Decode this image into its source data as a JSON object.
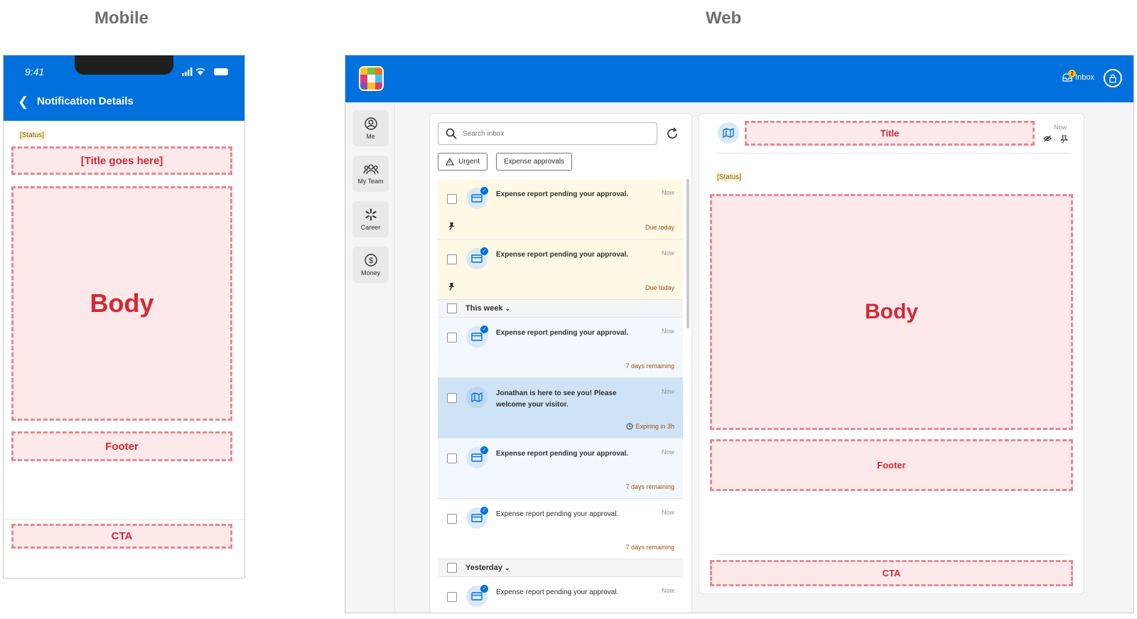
{
  "labels": {
    "mobile": "Mobile",
    "web": "Web"
  },
  "mobile": {
    "time": "9:41",
    "nav_title": "Notification Details",
    "status": "[Status]",
    "title_placeholder": "[Title goes here]",
    "body": "Body",
    "footer": "Footer",
    "cta": "CTA"
  },
  "web": {
    "header": {
      "inbox_label": "Inbox",
      "inbox_count": "2"
    },
    "rail": [
      {
        "label": "Me",
        "icon": "user-circle-icon"
      },
      {
        "label": "My Team",
        "icon": "team-icon"
      },
      {
        "label": "Career",
        "icon": "spark-icon"
      },
      {
        "label": "Money",
        "icon": "dollar-icon"
      }
    ],
    "search": {
      "placeholder": "Search inbox"
    },
    "chips": [
      {
        "label": "Urgent",
        "icon": "warning-icon"
      },
      {
        "label": "Expense approvals"
      }
    ],
    "items": [
      {
        "text": "Expense report pending your approval.",
        "time": "Now",
        "tag": "Due today",
        "state": "pinned",
        "icon": "card-icon"
      },
      {
        "text": "Expense report pending your approval.",
        "time": "Now",
        "tag": "Due today",
        "state": "pinned",
        "icon": "card-icon"
      }
    ],
    "group_this_week": "This week",
    "items_week": [
      {
        "text": "Expense report pending your approval.",
        "time": "Now",
        "tag": "7 days remaining",
        "state": "unread",
        "icon": "card-icon"
      },
      {
        "text": "Jonathan is here to see you! Please welcome your visitor.",
        "time": "Now",
        "tag": "Expiring in 3h",
        "state": "selected",
        "icon": "map-icon"
      },
      {
        "text": "Expense report pending your approval.",
        "time": "Now",
        "tag": "7 days remaining",
        "state": "unread",
        "icon": "card-icon"
      },
      {
        "text": "Expense report pending your approval.",
        "time": "Now",
        "tag": "7 days remaining",
        "state": "read",
        "icon": "card-icon"
      }
    ],
    "group_yesterday": "Yesterday",
    "items_yesterday": [
      {
        "text": "Expense report pending your approval.",
        "time": "Now"
      }
    ],
    "detail": {
      "title": "Title",
      "time": "Now",
      "status": "[Status]",
      "body": "Body",
      "footer": "Footer",
      "cta": "CTA"
    }
  },
  "colors": {
    "brand_blue": "#0071dc",
    "placeholder_red": "#d22a35",
    "placeholder_fill": "#fde8ea",
    "pinned_bg": "#fff8e5",
    "selected_bg": "#cfe3f6"
  }
}
